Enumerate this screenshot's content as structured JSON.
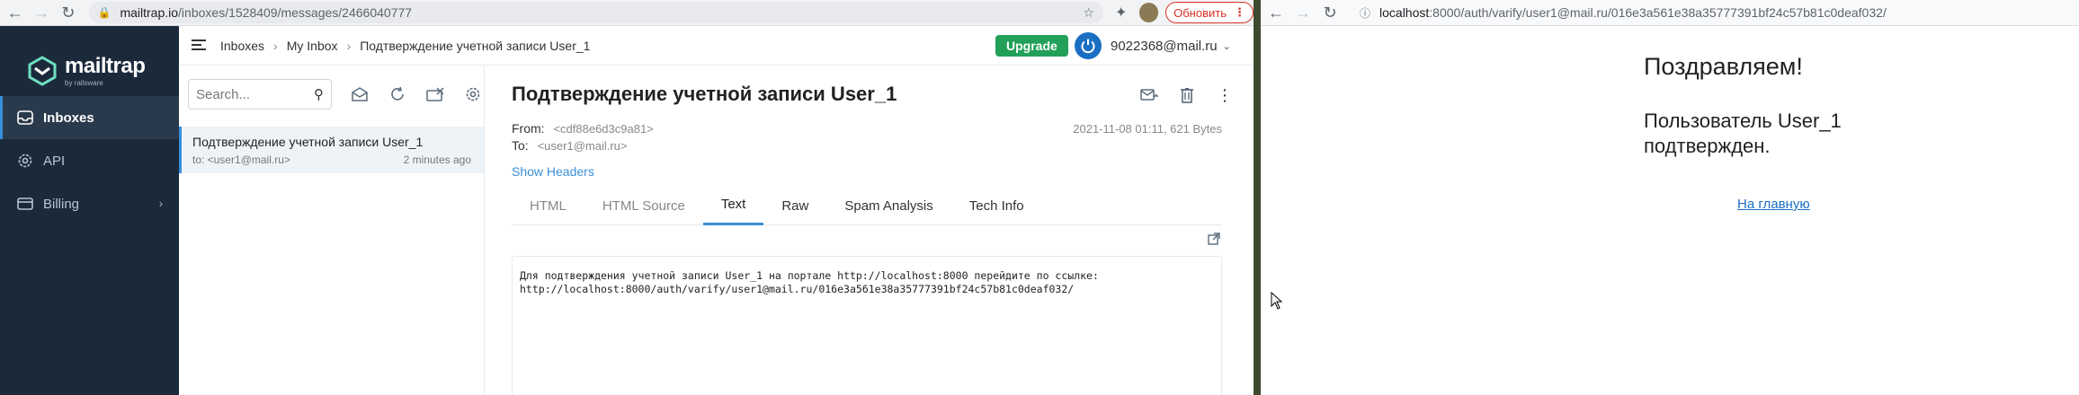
{
  "left_browser": {
    "url_host": "mailtrap.io",
    "url_path": "/inboxes/1528409/messages/2466040777",
    "update_button": "Обновить"
  },
  "right_browser": {
    "url_host": "localhost",
    "url_path": ":8000/auth/varify/user1@mail.ru/016e3a561e38a35777391bf24c57b81c0deaf032/"
  },
  "sidebar": {
    "logo_name": "mailtrap",
    "logo_sub": "by railsware",
    "items": [
      {
        "label": "Inboxes"
      },
      {
        "label": "API"
      },
      {
        "label": "Billing"
      }
    ]
  },
  "topbar": {
    "crumbs": [
      "Inboxes",
      "My Inbox",
      "Подтверждение учетной записи User_1"
    ],
    "upgrade": "Upgrade",
    "account": "9022368@mail.ru"
  },
  "msglist": {
    "search_placeholder": "Search...",
    "item": {
      "subject": "Подтверждение учетной записи User_1",
      "to": "to: <user1@mail.ru>",
      "time": "2 minutes ago"
    }
  },
  "message": {
    "subject": "Подтверждение учетной записи User_1",
    "from_label": "From:",
    "from_addr": "<cdf88e6d3c9a81>",
    "to_label": "To:",
    "to_addr": "<user1@mail.ru>",
    "date_size": "2021-11-08 01:11, 621 Bytes",
    "show_headers": "Show Headers",
    "tabs": [
      "HTML",
      "HTML Source",
      "Text",
      "Raw",
      "Spam Analysis",
      "Tech Info"
    ],
    "active_tab": "Text",
    "body_line1": "Для подтверждения учетной записи User_1 на портале http://localhost:8000 перейдите по ссылке:",
    "body_line2": "http://localhost:8000/auth/varify/user1@mail.ru/016e3a561e38a35777391bf24c57b81c0deaf032/"
  },
  "confirm_page": {
    "title": "Поздравляем!",
    "message": "Пользователь User_1 подтвержден.",
    "home_link": "На главную"
  },
  "colors": {
    "sidebar_bg": "#1b2a3b",
    "accent": "#3a8fd9",
    "upgrade": "#22a05a"
  }
}
